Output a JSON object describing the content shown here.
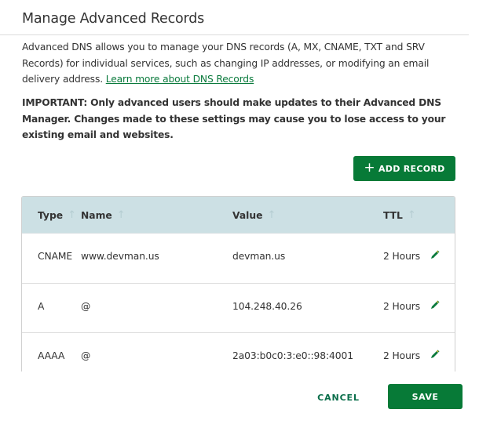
{
  "dialog": {
    "title": "Manage Advanced Records",
    "description": "Advanced DNS allows you to manage your DNS records (A, MX, CNAME, TXT and SRV Records) for individual services, such as changing IP addresses, or modifying an email delivery address. ",
    "learn_more_link": "Learn more about DNS Records",
    "warning": "IMPORTANT: Only advanced users should make updates to their Advanced DNS Manager. Changes made to these settings may cause you to lose access to your existing email and websites."
  },
  "toolbar": {
    "add_record_icon": "plus-icon",
    "add_record_label": "ADD RECORD"
  },
  "table": {
    "columns": [
      {
        "label": "Type",
        "sort_icon": "arrow-up-icon"
      },
      {
        "label": "Name",
        "sort_icon": "arrow-up-icon"
      },
      {
        "label": "Value",
        "sort_icon": "arrow-up-icon"
      },
      {
        "label": "TTL",
        "sort_icon": "arrow-up-icon"
      }
    ],
    "rows": [
      {
        "type": "CNAME",
        "name": "www.devman.us",
        "value": "devman.us",
        "ttl": "2 Hours",
        "action_icon": "pencil-icon"
      },
      {
        "type": "A",
        "name": "@",
        "value": "104.248.40.26",
        "ttl": "2 Hours",
        "action_icon": "pencil-icon"
      },
      {
        "type": "AAAA",
        "name": "@",
        "value": "2a03:b0c0:3:e0::98:4001",
        "ttl": "2 Hours",
        "action_icon": "pencil-icon"
      }
    ]
  },
  "footer": {
    "cancel_label": "CANCEL",
    "save_label": "SAVE"
  },
  "colors": {
    "primary_green": "#077a37",
    "link_green": "#0a7a3c",
    "table_header_bg": "#cce0e4",
    "text": "#333333"
  }
}
